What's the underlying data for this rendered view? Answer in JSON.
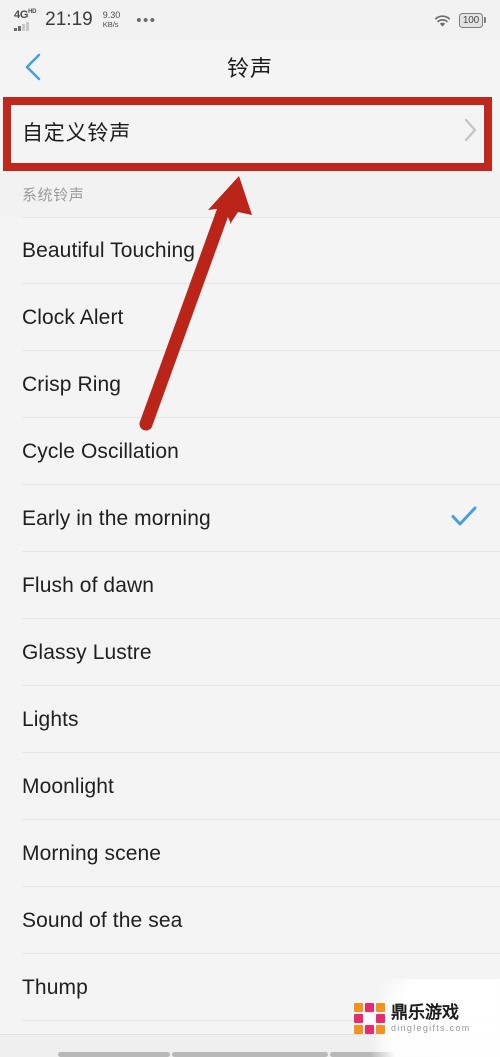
{
  "statusbar": {
    "network_type": "4G",
    "network_sub": "HD",
    "time": "21:19",
    "speed_value": "9.30",
    "speed_unit": "KB/s",
    "overflow": "•••",
    "wifi_icon": "wifi-icon",
    "battery_level": "100"
  },
  "header": {
    "back_icon": "chevron-left-icon",
    "title": "铃声"
  },
  "custom_row": {
    "label": "自定义铃声",
    "chevron_icon": "chevron-right-icon"
  },
  "section": {
    "title": "系统铃声"
  },
  "ringtones": [
    {
      "name": "Beautiful Touching",
      "selected": false
    },
    {
      "name": "Clock Alert",
      "selected": false
    },
    {
      "name": "Crisp Ring",
      "selected": false
    },
    {
      "name": "Cycle Oscillation",
      "selected": false
    },
    {
      "name": "Early in the morning",
      "selected": true
    },
    {
      "name": "Flush of dawn",
      "selected": false
    },
    {
      "name": "Glassy Lustre",
      "selected": false
    },
    {
      "name": "Lights",
      "selected": false
    },
    {
      "name": "Moonlight",
      "selected": false
    },
    {
      "name": "Morning scene",
      "selected": false
    },
    {
      "name": "Sound of the sea",
      "selected": false
    },
    {
      "name": "Thump",
      "selected": false
    }
  ],
  "annotation": {
    "box_color": "#c1281d",
    "arrow_color": "#bb2419",
    "arrow_target": "custom-ringtone-row"
  },
  "watermark": {
    "brand_cn": "鼎乐游戏",
    "brand_url": "dinglegifts.com",
    "color_orange": "#f5921e",
    "color_pink": "#ea2a6e"
  },
  "colors": {
    "accent_check": "#4a9fe0",
    "back_chevron": "#4a9fe0",
    "page_bg": "#f4f4f4",
    "section_bg": "#f2f2f2",
    "divider": "#e6e6e6"
  }
}
